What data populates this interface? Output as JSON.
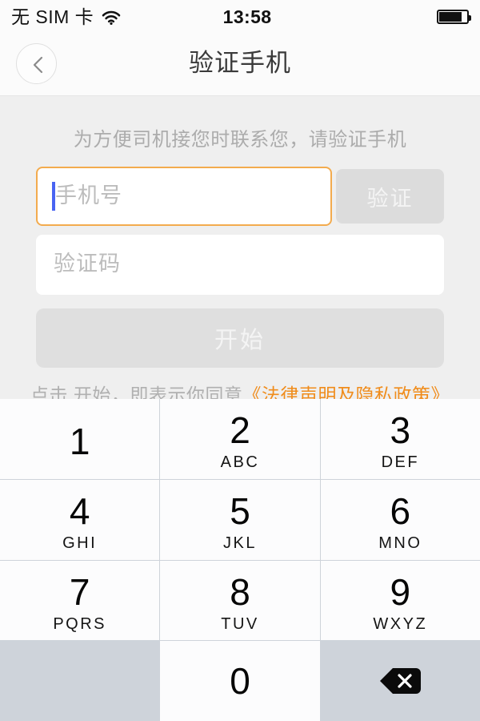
{
  "status_bar": {
    "carrier": "无 SIM 卡",
    "wifi_icon": "wifi-icon",
    "time": "13:58",
    "battery_icon": "battery-icon",
    "battery_level_percent": 78
  },
  "nav_bar": {
    "back_icon": "chevron-left-icon",
    "title": "验证手机"
  },
  "form": {
    "hint": "为方便司机接您时联系您，请验证手机",
    "phone_field": {
      "placeholder": "手机号",
      "value": "",
      "focused": true,
      "border_color": "#f3ab4e",
      "caret_color": "#4964f2"
    },
    "verify_button": {
      "label": "验证",
      "disabled": true,
      "background": "#dcdcdc",
      "text_color": "#f4f4f4"
    },
    "code_field": {
      "placeholder": "验证码",
      "value": ""
    },
    "start_button": {
      "label": "开始",
      "disabled": true,
      "background": "#dfdfdf",
      "text_color": "#f4f4f4"
    },
    "terms": {
      "prefix": "点击 开始，即表示你同意",
      "link": "《法律声明及隐私政策》",
      "link_color": "#f08c1b"
    }
  },
  "keyboard": {
    "type": "numeric-phone-pad",
    "background": "#ced3da",
    "key_background": "#fcfcfd",
    "keys": [
      {
        "digit": "1",
        "letters": ""
      },
      {
        "digit": "2",
        "letters": "ABC"
      },
      {
        "digit": "3",
        "letters": "DEF"
      },
      {
        "digit": "4",
        "letters": "GHI"
      },
      {
        "digit": "5",
        "letters": "JKL"
      },
      {
        "digit": "6",
        "letters": "MNO"
      },
      {
        "digit": "7",
        "letters": "PQRS"
      },
      {
        "digit": "8",
        "letters": "TUV"
      },
      {
        "digit": "9",
        "letters": "WXYZ"
      },
      {
        "digit": "",
        "letters": ""
      },
      {
        "digit": "0",
        "letters": ""
      },
      {
        "digit": "",
        "letters": "",
        "icon": "backspace-icon"
      }
    ]
  }
}
